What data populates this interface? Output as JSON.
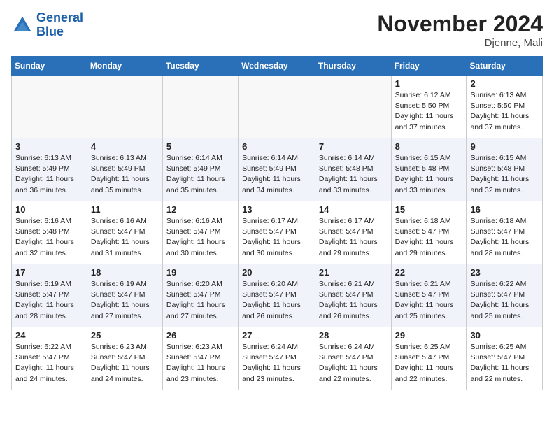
{
  "header": {
    "logo_line1": "General",
    "logo_line2": "Blue",
    "title": "November 2024",
    "subtitle": "Djenne, Mali"
  },
  "weekdays": [
    "Sunday",
    "Monday",
    "Tuesday",
    "Wednesday",
    "Thursday",
    "Friday",
    "Saturday"
  ],
  "weeks": [
    [
      {
        "day": "",
        "info": ""
      },
      {
        "day": "",
        "info": ""
      },
      {
        "day": "",
        "info": ""
      },
      {
        "day": "",
        "info": ""
      },
      {
        "day": "",
        "info": ""
      },
      {
        "day": "1",
        "info": "Sunrise: 6:12 AM\nSunset: 5:50 PM\nDaylight: 11 hours\nand 37 minutes."
      },
      {
        "day": "2",
        "info": "Sunrise: 6:13 AM\nSunset: 5:50 PM\nDaylight: 11 hours\nand 37 minutes."
      }
    ],
    [
      {
        "day": "3",
        "info": "Sunrise: 6:13 AM\nSunset: 5:49 PM\nDaylight: 11 hours\nand 36 minutes."
      },
      {
        "day": "4",
        "info": "Sunrise: 6:13 AM\nSunset: 5:49 PM\nDaylight: 11 hours\nand 35 minutes."
      },
      {
        "day": "5",
        "info": "Sunrise: 6:14 AM\nSunset: 5:49 PM\nDaylight: 11 hours\nand 35 minutes."
      },
      {
        "day": "6",
        "info": "Sunrise: 6:14 AM\nSunset: 5:49 PM\nDaylight: 11 hours\nand 34 minutes."
      },
      {
        "day": "7",
        "info": "Sunrise: 6:14 AM\nSunset: 5:48 PM\nDaylight: 11 hours\nand 33 minutes."
      },
      {
        "day": "8",
        "info": "Sunrise: 6:15 AM\nSunset: 5:48 PM\nDaylight: 11 hours\nand 33 minutes."
      },
      {
        "day": "9",
        "info": "Sunrise: 6:15 AM\nSunset: 5:48 PM\nDaylight: 11 hours\nand 32 minutes."
      }
    ],
    [
      {
        "day": "10",
        "info": "Sunrise: 6:16 AM\nSunset: 5:48 PM\nDaylight: 11 hours\nand 32 minutes."
      },
      {
        "day": "11",
        "info": "Sunrise: 6:16 AM\nSunset: 5:47 PM\nDaylight: 11 hours\nand 31 minutes."
      },
      {
        "day": "12",
        "info": "Sunrise: 6:16 AM\nSunset: 5:47 PM\nDaylight: 11 hours\nand 30 minutes."
      },
      {
        "day": "13",
        "info": "Sunrise: 6:17 AM\nSunset: 5:47 PM\nDaylight: 11 hours\nand 30 minutes."
      },
      {
        "day": "14",
        "info": "Sunrise: 6:17 AM\nSunset: 5:47 PM\nDaylight: 11 hours\nand 29 minutes."
      },
      {
        "day": "15",
        "info": "Sunrise: 6:18 AM\nSunset: 5:47 PM\nDaylight: 11 hours\nand 29 minutes."
      },
      {
        "day": "16",
        "info": "Sunrise: 6:18 AM\nSunset: 5:47 PM\nDaylight: 11 hours\nand 28 minutes."
      }
    ],
    [
      {
        "day": "17",
        "info": "Sunrise: 6:19 AM\nSunset: 5:47 PM\nDaylight: 11 hours\nand 28 minutes."
      },
      {
        "day": "18",
        "info": "Sunrise: 6:19 AM\nSunset: 5:47 PM\nDaylight: 11 hours\nand 27 minutes."
      },
      {
        "day": "19",
        "info": "Sunrise: 6:20 AM\nSunset: 5:47 PM\nDaylight: 11 hours\nand 27 minutes."
      },
      {
        "day": "20",
        "info": "Sunrise: 6:20 AM\nSunset: 5:47 PM\nDaylight: 11 hours\nand 26 minutes."
      },
      {
        "day": "21",
        "info": "Sunrise: 6:21 AM\nSunset: 5:47 PM\nDaylight: 11 hours\nand 26 minutes."
      },
      {
        "day": "22",
        "info": "Sunrise: 6:21 AM\nSunset: 5:47 PM\nDaylight: 11 hours\nand 25 minutes."
      },
      {
        "day": "23",
        "info": "Sunrise: 6:22 AM\nSunset: 5:47 PM\nDaylight: 11 hours\nand 25 minutes."
      }
    ],
    [
      {
        "day": "24",
        "info": "Sunrise: 6:22 AM\nSunset: 5:47 PM\nDaylight: 11 hours\nand 24 minutes."
      },
      {
        "day": "25",
        "info": "Sunrise: 6:23 AM\nSunset: 5:47 PM\nDaylight: 11 hours\nand 24 minutes."
      },
      {
        "day": "26",
        "info": "Sunrise: 6:23 AM\nSunset: 5:47 PM\nDaylight: 11 hours\nand 23 minutes."
      },
      {
        "day": "27",
        "info": "Sunrise: 6:24 AM\nSunset: 5:47 PM\nDaylight: 11 hours\nand 23 minutes."
      },
      {
        "day": "28",
        "info": "Sunrise: 6:24 AM\nSunset: 5:47 PM\nDaylight: 11 hours\nand 22 minutes."
      },
      {
        "day": "29",
        "info": "Sunrise: 6:25 AM\nSunset: 5:47 PM\nDaylight: 11 hours\nand 22 minutes."
      },
      {
        "day": "30",
        "info": "Sunrise: 6:25 AM\nSunset: 5:47 PM\nDaylight: 11 hours\nand 22 minutes."
      }
    ]
  ]
}
